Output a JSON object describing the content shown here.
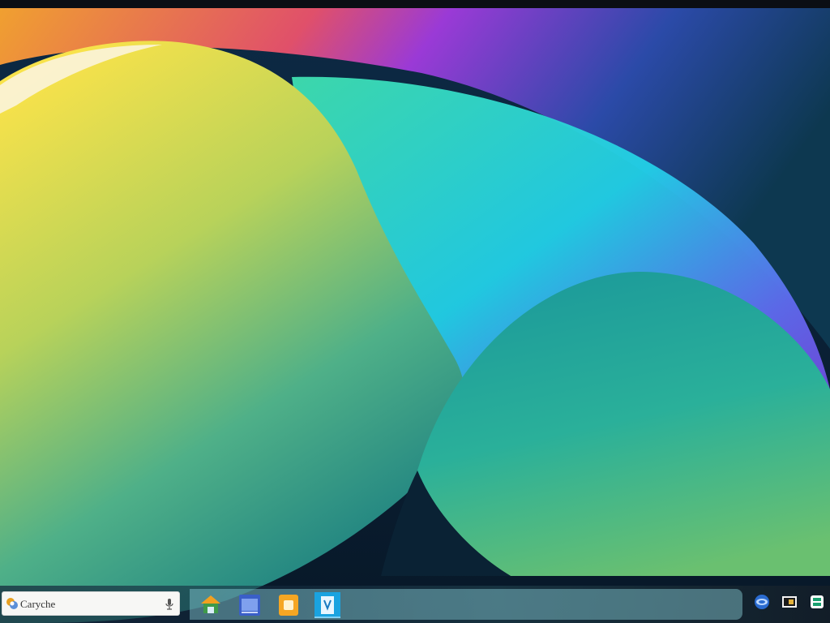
{
  "taskbar": {
    "search": {
      "text": "Caryche",
      "icon": "app-logo-icon",
      "mic_icon": "microphone-icon"
    },
    "pinned_apps": [
      {
        "icon": "home-folder-icon"
      },
      {
        "icon": "window-app-icon"
      },
      {
        "icon": "notes-app-icon"
      },
      {
        "icon": "document-app-icon"
      }
    ],
    "tray": [
      {
        "icon": "globe-icon"
      },
      {
        "icon": "media-app-icon"
      },
      {
        "icon": "window-switch-icon"
      }
    ]
  },
  "colors": {
    "accent_yellow": "#f5e04a",
    "accent_cyan": "#1fd7e8",
    "accent_purple": "#7a5cff",
    "accent_green": "#3fb87a"
  }
}
